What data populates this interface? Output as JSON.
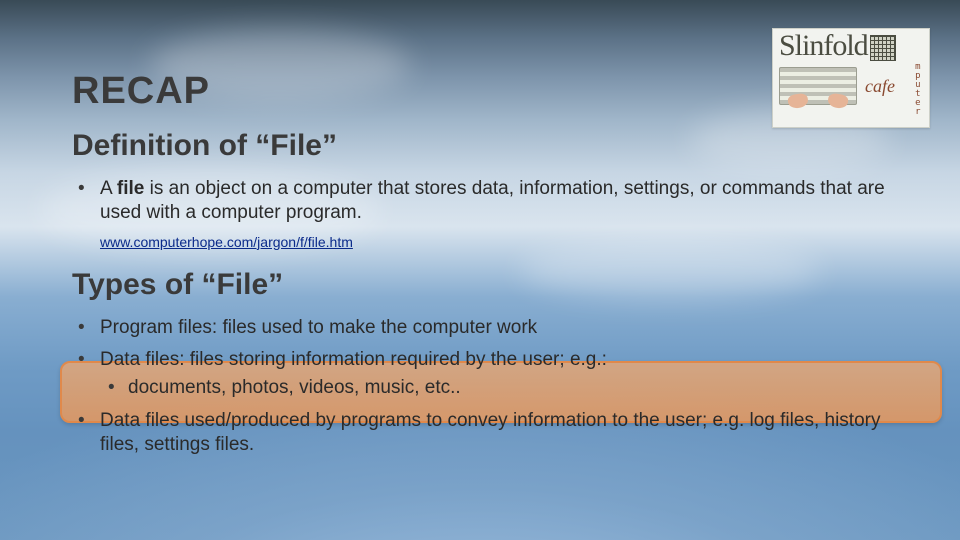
{
  "logo": {
    "brand": "Slinfold",
    "vertical": "computer",
    "cafe": "cafe"
  },
  "recap_label": "RECAP",
  "section1": {
    "title": "Definition of “File”",
    "bullet_pre": "A ",
    "bullet_bold": "file",
    "bullet_post": " is an object on a computer that stores data, information, settings, or commands that are used with a computer program.",
    "source": "www.computerhope.com/jargon/f/file.htm"
  },
  "section2": {
    "title": "Types of “File”",
    "items": [
      "Program files: files used to make the computer work",
      "Data files: files storing information required by the user; e.g.:",
      "Data files used/produced by programs to convey information to the user; e.g. log files, history files, settings files."
    ],
    "sub_item": "documents, photos, videos, music, etc.."
  }
}
